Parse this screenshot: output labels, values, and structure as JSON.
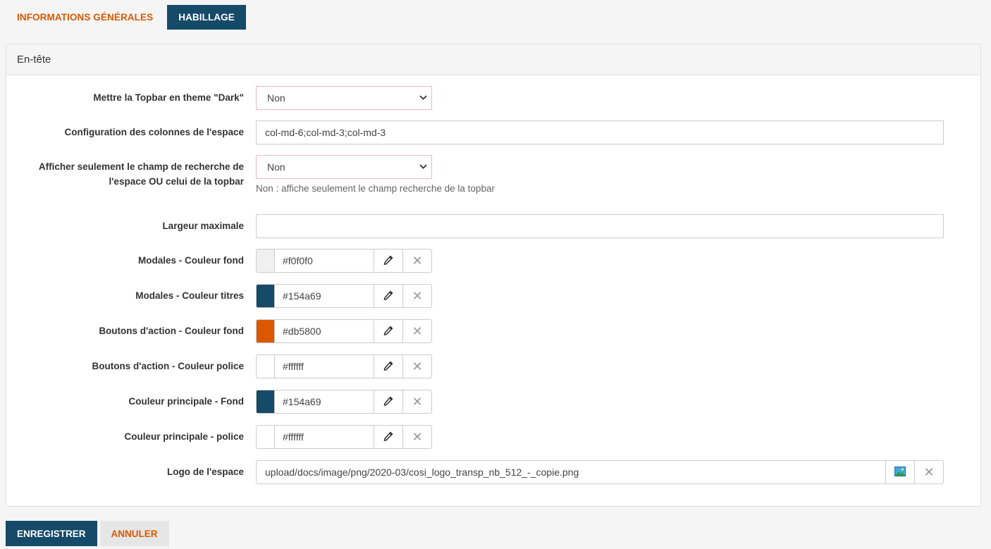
{
  "tabs": [
    {
      "label": "INFORMATIONS GÉNÉRALES"
    },
    {
      "label": "HABILLAGE"
    }
  ],
  "panel": {
    "title": "En-tête"
  },
  "fields": {
    "topbar_dark": {
      "label": "Mettre la Topbar en theme \"Dark\"",
      "value": "Non"
    },
    "columns": {
      "label": "Configuration des colonnes de l'espace",
      "value": "col-md-6;col-md-3;col-md-3"
    },
    "search_only": {
      "label_line1": "Afficher seulement le champ de recherche de",
      "label_line2": "l'espace OU celui de la topbar",
      "value": "Non",
      "help": "Non : affiche seulement le champ recherche de la topbar"
    },
    "max_width": {
      "label": "Largeur maximale",
      "value": ""
    },
    "colors": [
      {
        "label": "Modales - Couleur fond",
        "value": "#f0f0f0",
        "swatch": "#f0f0f0"
      },
      {
        "label": "Modales - Couleur titres",
        "value": "#154a69",
        "swatch": "#154a69"
      },
      {
        "label": "Boutons d'action - Couleur fond",
        "value": "#db5800",
        "swatch": "#db5800"
      },
      {
        "label": "Boutons d'action - Couleur police",
        "value": "#ffffff",
        "swatch": "#ffffff"
      },
      {
        "label": "Couleur principale - Fond",
        "value": "#154a69",
        "swatch": "#154a69"
      },
      {
        "label": "Couleur principale - police",
        "value": "#ffffff",
        "swatch": "#ffffff"
      }
    ],
    "logo": {
      "label": "Logo de l'espace",
      "value": "upload/docs/image/png/2020-03/cosi_logo_transp_nb_512_-_copie.png"
    }
  },
  "icons": {
    "eyedropper": "eyedropper-icon",
    "clear": "close-icon",
    "image": "image-icon",
    "chevron": "chevron-down-icon"
  },
  "footer": {
    "save_label": "ENREGISTRER",
    "cancel_label": "ANNULER"
  },
  "theme": {
    "primary": "#154a69",
    "accent": "#db5800"
  }
}
